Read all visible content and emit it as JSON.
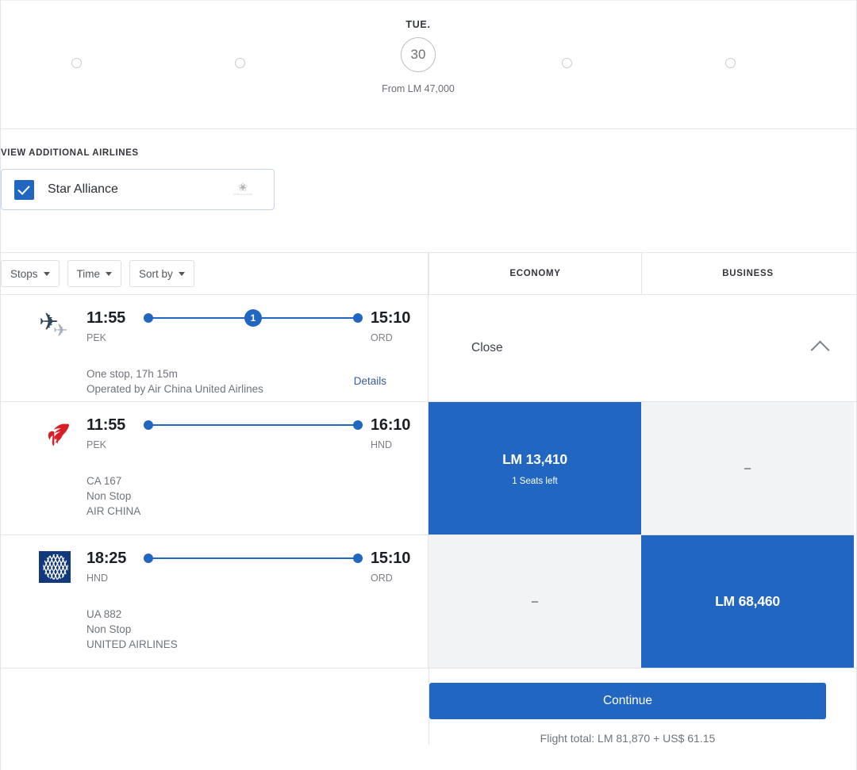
{
  "date_carousel": {
    "selected": {
      "dow": "TUE.",
      "day": "30",
      "from_price": "From LM 47,000"
    },
    "placeholder_count": 4
  },
  "additional_airlines": {
    "title": "VIEW ADDITIONAL AIRLINES",
    "alliance": {
      "label": "Star Alliance",
      "checked": true,
      "logo_star": "✬",
      "logo_text": "STAR ALLIANCE"
    }
  },
  "filters": [
    {
      "label": "Stops",
      "name": "stops"
    },
    {
      "label": "Time",
      "name": "time"
    },
    {
      "label": "Sort by",
      "name": "sort-by"
    }
  ],
  "fare_columns": [
    {
      "label": "ECONOMY"
    },
    {
      "label": "BUSINESS"
    }
  ],
  "itinerary_summary": {
    "icon": "plane-pair-icon",
    "depart_time": "11:55",
    "depart_airport": "PEK",
    "arrive_time": "15:10",
    "arrive_airport": "ORD",
    "stops_badge": "1",
    "duration_line": "One stop, 17h 15m",
    "operator_line": "Operated by Air China United Airlines",
    "details_label": "Details",
    "close_label": "Close"
  },
  "segments": [
    {
      "airline_logo": "air-china-logo",
      "depart_time": "11:55",
      "depart_airport": "PEK",
      "arrive_time": "16:10",
      "arrive_airport": "HND",
      "flight_number": "CA 167",
      "stops": "Non Stop",
      "airline_name": "AIR CHINA",
      "economy": {
        "price": "LM 13,410",
        "seats": "1 Seats left",
        "selected": true
      },
      "business": {
        "price": "–",
        "seats": "",
        "selected": false
      }
    },
    {
      "airline_logo": "united-airlines-logo",
      "depart_time": "18:25",
      "depart_airport": "HND",
      "arrive_time": "15:10",
      "arrive_airport": "ORD",
      "flight_number": "UA 882",
      "stops": "Non Stop",
      "airline_name": "UNITED AIRLINES",
      "economy": {
        "price": "–",
        "seats": "",
        "selected": false
      },
      "business": {
        "price": "LM 68,460",
        "seats": "",
        "selected": true
      }
    }
  ],
  "footer": {
    "continue_label": "Continue",
    "flight_total": "Flight total: LM 81,870 + US$ 61.15"
  },
  "colors": {
    "accent_blue": "#2166c0",
    "empty_cell": "#f2f3f5",
    "border": "#e3e5e8",
    "link": "#3d5a96"
  }
}
